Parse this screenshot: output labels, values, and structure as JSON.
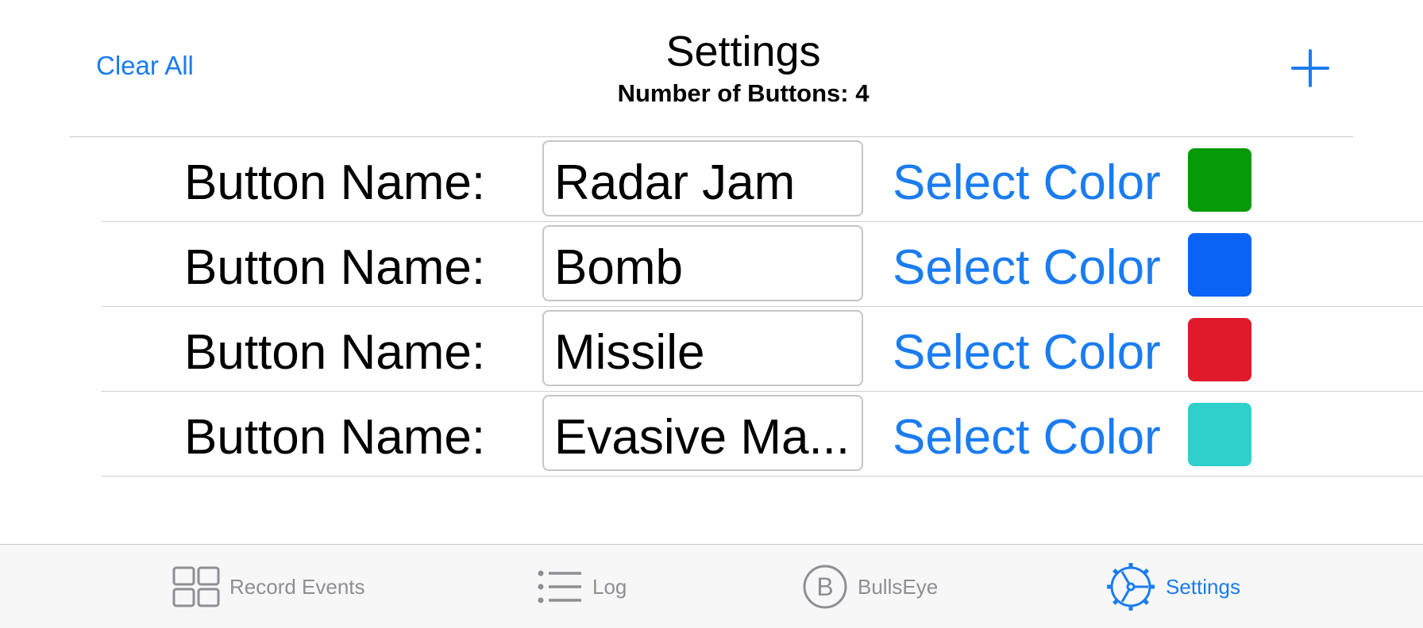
{
  "navbar": {
    "left_action": "Clear All",
    "title": "Settings",
    "subtitle": "Number of Buttons: 4",
    "add_icon": "plus-icon"
  },
  "rows": [
    {
      "label": "Button Name:",
      "name": "Radar Jam",
      "action": "Select Color",
      "color": "#069a09"
    },
    {
      "label": "Button Name:",
      "name": "Bomb",
      "action": "Select Color",
      "color": "#0a63f5"
    },
    {
      "label": "Button Name:",
      "name": "Missile",
      "action": "Select Color",
      "color": "#e01a2b"
    },
    {
      "label": "Button Name:",
      "name": "Evasive Ma...",
      "action": "Select Color",
      "color": "#2fd0cc"
    }
  ],
  "tabbar": {
    "tabs": [
      {
        "label": "Record Events",
        "icon": "grid-icon",
        "active": false
      },
      {
        "label": "Log",
        "icon": "list-icon",
        "active": false
      },
      {
        "label": "BullsEye",
        "icon": "circle-b-icon",
        "active": false
      },
      {
        "label": "Settings",
        "icon": "gear-icon",
        "active": true
      }
    ]
  },
  "colors": {
    "accent": "#1a7cf0",
    "inactive": "#8e8e93",
    "tabbar_bg": "#f7f7f7"
  }
}
